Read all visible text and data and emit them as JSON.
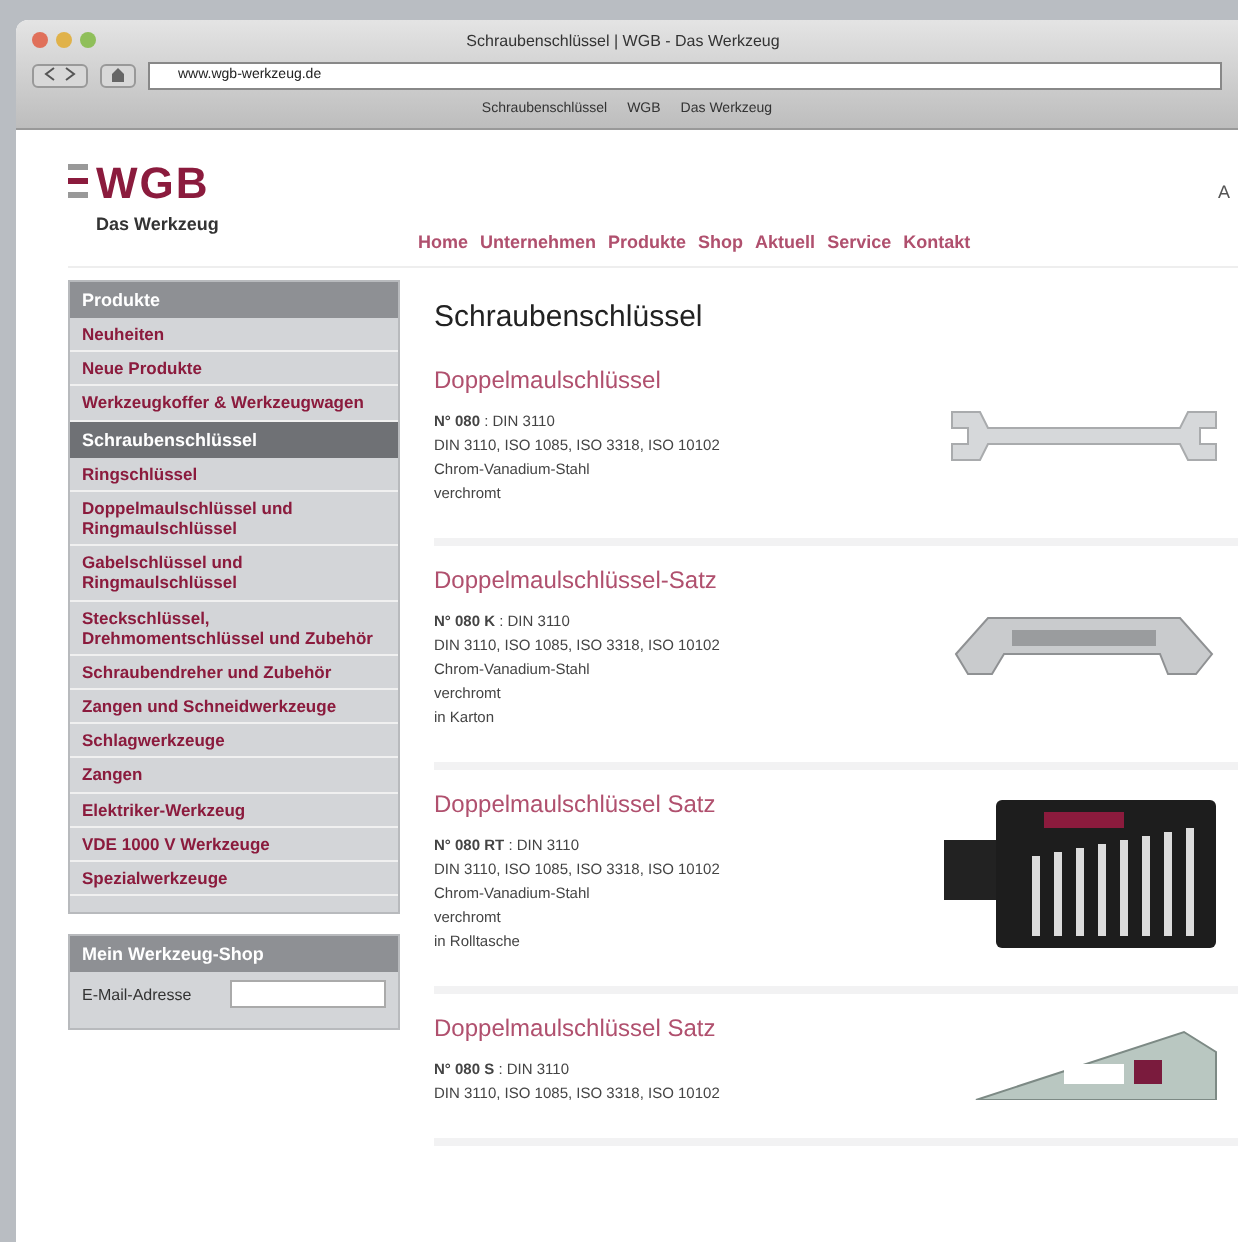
{
  "window": {
    "title": "Schraubenschlüssel | WGB - Das Werkzeug",
    "url": "www.wgb-werkzeug.de",
    "bookmarks": [
      "Schraubenschlüssel",
      "WGB",
      "Das Werkzeug"
    ]
  },
  "site": {
    "logo": "WGB",
    "tagline": "Das Werkzeug",
    "top_right": "A"
  },
  "nav": [
    "Home",
    "Unternehmen",
    "Produkte",
    "Shop",
    "Aktuell",
    "Service",
    "Kontakt"
  ],
  "sidebar": {
    "sections": [
      {
        "title": "Produkte",
        "selected": false,
        "items": [
          "Neuheiten",
          "Neue Produkte",
          "Werkzeugkoffer & Werkzeugwagen"
        ]
      },
      {
        "title": "Schraubenschlüssel",
        "selected": true,
        "items": [
          "Ringschlüssel",
          "Doppelmaulschlüssel und Ringmaulschlüssel",
          "Gabelschlüssel und Ringmaulschlüssel",
          "Steckschlüssel, Drehmomentschlüssel und Zubehör",
          "Schraubendreher und Zubehör",
          "Zangen und Schneidwerkzeuge",
          "Schlagwerkzeuge",
          "Zangen",
          "Elektriker-Werkzeug",
          "VDE 1000 V Werkzeuge",
          "Spezialwerkzeuge"
        ]
      }
    ],
    "login": {
      "title": "Mein Werkzeug-Shop",
      "field_label": "E-Mail-Adresse"
    }
  },
  "content": {
    "heading": "Schraubenschlüssel",
    "products": [
      {
        "kind": "single",
        "title": "Doppelmaulschlüssel",
        "lines": [
          "**N° 080** : DIN 3110",
          "DIN 3110, ISO 1085, ISO 3318, ISO 10102",
          "Chrom-Vanadium-Stahl",
          "verchromt"
        ]
      },
      {
        "kind": "offset",
        "title": "Doppelmaulschlüssel-Satz",
        "lines": [
          "**N° 080 K** : DIN 3110",
          "DIN 3110, ISO 1085, ISO 3318, ISO 10102",
          "Chrom-Vanadium-Stahl",
          "verchromt",
          "in Karton"
        ]
      },
      {
        "kind": "roll",
        "title": "Doppelmaulschlüssel Satz",
        "lines": [
          "**N° 080 RT** : DIN 3110",
          "DIN 3110, ISO 1085, ISO 3318, ISO 10102",
          "Chrom-Vanadium-Stahl",
          "verchromt",
          "in Rolltasche"
        ]
      },
      {
        "kind": "case",
        "title": "Doppelmaulschlüssel Satz",
        "lines": [
          "**N° 080 S** : DIN 3110",
          "DIN 3110, ISO 1085, ISO 3318, ISO 10102"
        ]
      }
    ]
  }
}
